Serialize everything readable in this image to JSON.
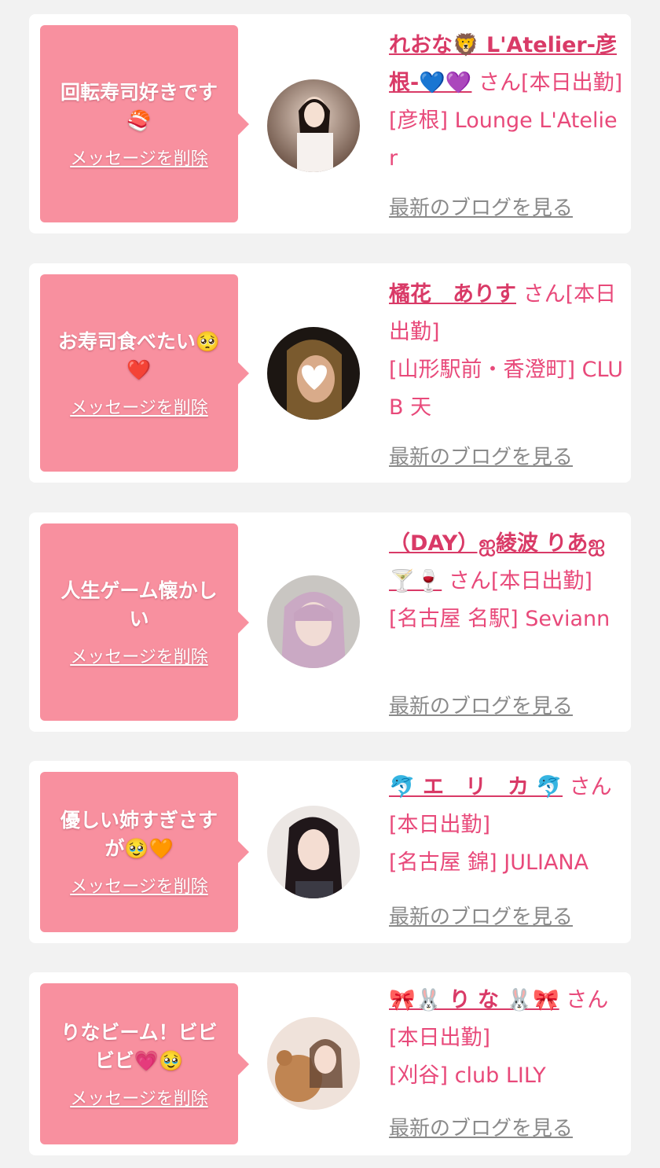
{
  "messages": [
    {
      "message": "回転寿司好きです🍣",
      "delete_label": "メッセージを削除",
      "cast_name": "れおな🦁 L'Atelier-彦根-💙💜",
      "suffix": " さん[本日出勤]",
      "shop": "[彦根] Lounge L'Atelier",
      "blog_label": "最新のブログを見る"
    },
    {
      "message": "お寿司食べたい🥺❤️",
      "delete_label": "メッセージを削除",
      "cast_name": "橘花　ありす",
      "suffix": " さん[本日出勤]",
      "shop": "[山形駅前・香澄町] CLUB 天",
      "blog_label": "最新のブログを見る"
    },
    {
      "message": "人生ゲーム懐かしい",
      "delete_label": "メッセージを削除",
      "cast_name": "（DAY）ஐ綾波 りあஐ🍸🍷",
      "suffix": " さん[本日出勤]",
      "shop": "[名古屋 名駅] Seviann",
      "blog_label": "最新のブログを見る"
    },
    {
      "message": "優しい姉すぎさすが🥹🧡",
      "delete_label": "メッセージを削除",
      "cast_name": "🐬 エ　リ　カ 🐬",
      "suffix": " さん[本日出勤]",
      "shop": "[名古屋 錦] JULIANA",
      "blog_label": "最新のブログを見る"
    },
    {
      "message": "りなビーム！ビビビビ💗🥹",
      "delete_label": "メッセージを削除",
      "cast_name": "🎀🐰 り な 🐰🎀",
      "suffix": " さん[本日出勤]",
      "shop": "[刈谷] club LILY",
      "blog_label": "最新のブログを見る"
    }
  ]
}
